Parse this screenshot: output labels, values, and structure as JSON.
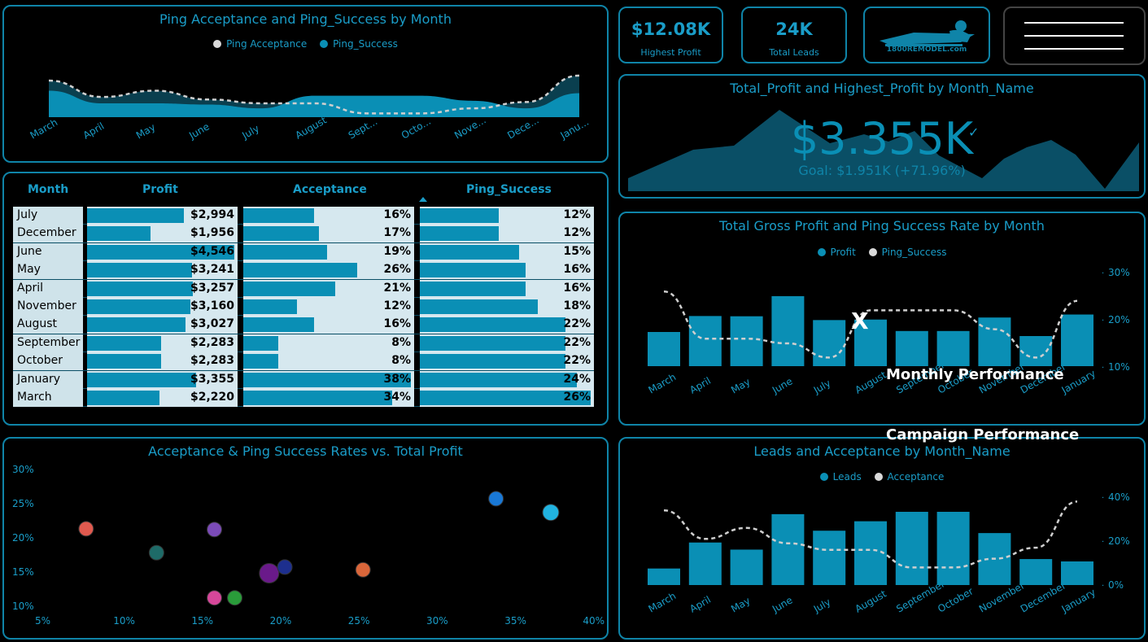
{
  "kpis": {
    "highest_profit": {
      "value": "$12.08K",
      "label": "Highest Profit"
    },
    "total_leads": {
      "value": "24K",
      "label": "Total Leads"
    }
  },
  "logo": {
    "text": "1800REMODEL.com"
  },
  "line_panel": {
    "title": "Ping Acceptance and Ping_Success by Month",
    "legend": [
      "Ping Acceptance",
      "Ping_Success"
    ],
    "months": [
      "March",
      "April",
      "May",
      "June",
      "July",
      "August",
      "Sept...",
      "Octo...",
      "Nove...",
      "Dece...",
      "Janu..."
    ]
  },
  "gauge_panel": {
    "title": "Total_Profit and Highest_Profit by Month_Name",
    "value": "$3.355K",
    "goal": "Goal: $1.951K (+71.96%)"
  },
  "table": {
    "headers": [
      "Month",
      "Profit",
      "Acceptance",
      "Ping_Success"
    ],
    "rows": [
      {
        "month": "July",
        "profit": "$2,994",
        "profit_f": 0.66,
        "acc": "16%",
        "acc_f": 0.42,
        "ping": "12%",
        "ping_f": 0.46
      },
      {
        "month": "December",
        "profit": "$1,956",
        "profit_f": 0.43,
        "acc": "17%",
        "acc_f": 0.45,
        "ping": "12%",
        "ping_f": 0.46
      },
      {
        "month": "June",
        "profit": "$4,546",
        "profit_f": 1.0,
        "acc": "19%",
        "acc_f": 0.5,
        "ping": "15%",
        "ping_f": 0.58
      },
      {
        "month": "May",
        "profit": "$3,241",
        "profit_f": 0.71,
        "acc": "26%",
        "acc_f": 0.68,
        "ping": "16%",
        "ping_f": 0.62
      },
      {
        "month": "April",
        "profit": "$3,257",
        "profit_f": 0.72,
        "acc": "21%",
        "acc_f": 0.55,
        "ping": "16%",
        "ping_f": 0.62
      },
      {
        "month": "November",
        "profit": "$3,160",
        "profit_f": 0.7,
        "acc": "12%",
        "acc_f": 0.32,
        "ping": "18%",
        "ping_f": 0.69
      },
      {
        "month": "August",
        "profit": "$3,027",
        "profit_f": 0.67,
        "acc": "16%",
        "acc_f": 0.42,
        "ping": "22%",
        "ping_f": 0.85
      },
      {
        "month": "September",
        "profit": "$2,283",
        "profit_f": 0.5,
        "acc": "8%",
        "acc_f": 0.21,
        "ping": "22%",
        "ping_f": 0.85
      },
      {
        "month": "October",
        "profit": "$2,283",
        "profit_f": 0.5,
        "acc": "8%",
        "acc_f": 0.21,
        "ping": "22%",
        "ping_f": 0.85
      },
      {
        "month": "January",
        "profit": "$3,355",
        "profit_f": 0.74,
        "acc": "38%",
        "acc_f": 1.0,
        "ping": "24%",
        "ping_f": 0.92
      },
      {
        "month": "March",
        "profit": "$2,220",
        "profit_f": 0.49,
        "acc": "34%",
        "acc_f": 0.89,
        "ping": "26%",
        "ping_f": 1.0
      }
    ]
  },
  "scatter_panel": {
    "title": "Acceptance & Ping Success Rates vs. Total Profit",
    "yticks": [
      "30%",
      "25%",
      "20%",
      "15%",
      "10%"
    ],
    "xticks": [
      "5%",
      "10%",
      "15%",
      "20%",
      "25%",
      "30%",
      "35%",
      "40%"
    ]
  },
  "combo1": {
    "title": "Total Gross Profit and Ping Success Rate by Month",
    "legend": [
      "Profit",
      "Ping_Success"
    ],
    "yticks": [
      "30%",
      "20%",
      "10%"
    ]
  },
  "combo2": {
    "title": "Leads and Acceptance by Month_Name",
    "legend": [
      "Leads",
      "Acceptance"
    ],
    "yticks": [
      "40%",
      "20%",
      "0%"
    ]
  },
  "overlays": {
    "x_mark": "X",
    "monthly": "Monthly Performance",
    "campaign": "Campaign Performance"
  },
  "colors": {
    "accent": "#1a9dc8",
    "bar": "#0a8fb5",
    "border": "#0f84a8"
  },
  "chart_data": [
    {
      "type": "area",
      "title": "Ping Acceptance and Ping_Success by Month",
      "categories": [
        "March",
        "April",
        "May",
        "June",
        "July",
        "August",
        "September",
        "October",
        "November",
        "December",
        "January"
      ],
      "series": [
        {
          "name": "Ping Acceptance",
          "values": [
            34,
            21,
            26,
            19,
            16,
            16,
            8,
            8,
            12,
            17,
            38
          ]
        },
        {
          "name": "Ping_Success",
          "values": [
            26,
            16,
            16,
            15,
            12,
            22,
            22,
            22,
            18,
            12,
            24
          ]
        }
      ]
    },
    {
      "type": "bar",
      "title": "Total Gross Profit and Ping Success Rate by Month",
      "categories": [
        "March",
        "April",
        "May",
        "June",
        "July",
        "August",
        "September",
        "October",
        "November",
        "December",
        "January"
      ],
      "series": [
        {
          "name": "Profit",
          "values": [
            2220,
            3257,
            3241,
            4546,
            2994,
            3027,
            2283,
            2283,
            3160,
            1956,
            3355
          ]
        },
        {
          "name": "Ping_Success",
          "values": [
            26,
            16,
            16,
            15,
            12,
            22,
            22,
            22,
            18,
            12,
            24
          ]
        }
      ],
      "ylim": [
        0.1,
        0.3
      ]
    },
    {
      "type": "bar",
      "title": "Leads and Acceptance by Month_Name",
      "categories": [
        "March",
        "April",
        "May",
        "June",
        "July",
        "August",
        "September",
        "October",
        "November",
        "December",
        "January"
      ],
      "series": [
        {
          "name": "Leads",
          "values": [
            0.7,
            1.8,
            1.5,
            3.0,
            2.3,
            2.7,
            3.1,
            3.1,
            2.2,
            1.1,
            1.0
          ]
        },
        {
          "name": "Acceptance",
          "values": [
            34,
            21,
            26,
            19,
            16,
            16,
            8,
            8,
            12,
            17,
            38
          ]
        }
      ],
      "ylim": [
        0,
        0.4
      ]
    },
    {
      "type": "scatter",
      "title": "Acceptance & Ping Success Rates vs. Total Profit",
      "xlim": [
        0.05,
        0.4
      ],
      "ylim": [
        0.1,
        0.3
      ],
      "points": [
        {
          "x": 0.078,
          "y": 0.218,
          "color": "#e05a4f"
        },
        {
          "x": 0.123,
          "y": 0.183,
          "color": "#1e6b68"
        },
        {
          "x": 0.16,
          "y": 0.217,
          "color": "#7b4bb8"
        },
        {
          "x": 0.16,
          "y": 0.117,
          "color": "#d6479a"
        },
        {
          "x": 0.173,
          "y": 0.117,
          "color": "#2a9c3a"
        },
        {
          "x": 0.195,
          "y": 0.153,
          "color": "#6a1a8a"
        },
        {
          "x": 0.205,
          "y": 0.162,
          "color": "#1d2f8e"
        },
        {
          "x": 0.255,
          "y": 0.158,
          "color": "#d9663a"
        },
        {
          "x": 0.34,
          "y": 0.262,
          "color": "#1978d6"
        },
        {
          "x": 0.375,
          "y": 0.242,
          "color": "#21b3e0"
        }
      ]
    }
  ]
}
